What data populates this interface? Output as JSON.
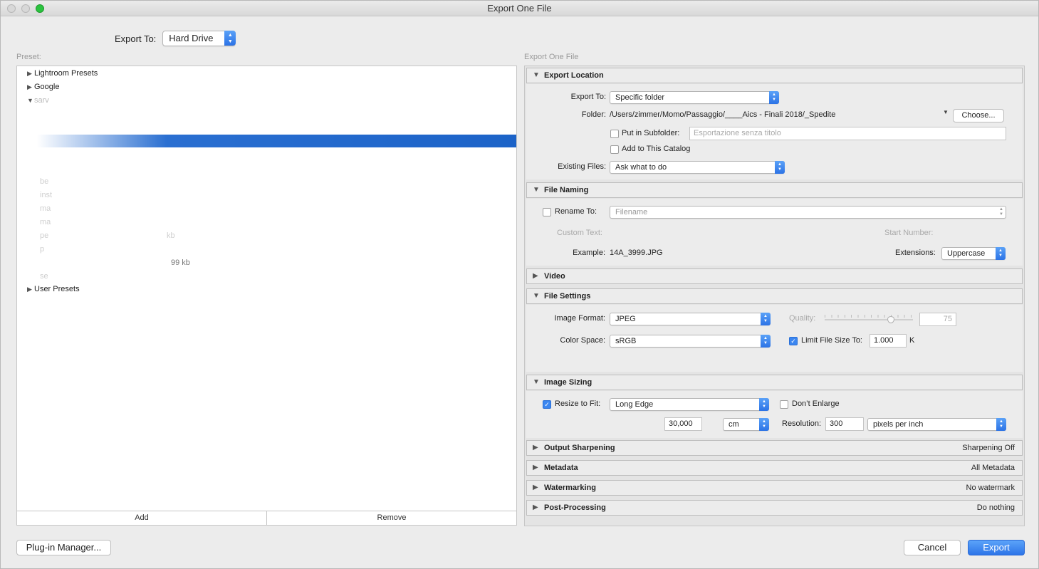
{
  "window": {
    "title": "Export One File"
  },
  "top": {
    "export_to_label": "Export To:",
    "export_to_value": "Hard Drive"
  },
  "preset": {
    "caption": "Preset:",
    "items": [
      {
        "label": "Lightroom Presets",
        "expanded": false
      },
      {
        "label": "Google",
        "expanded": false
      },
      {
        "label": "sarv",
        "expanded": true
      },
      {
        "label": "User Presets",
        "expanded": false
      }
    ],
    "faded_items": [
      "be",
      "inst",
      "ma",
      "ma",
      "pe",
      "kb",
      "p",
      "99 kb",
      "se"
    ],
    "add_label": "Add",
    "remove_label": "Remove"
  },
  "right": {
    "caption": "Export One File"
  },
  "export_location": {
    "title": "Export Location",
    "export_to_label": "Export To:",
    "export_to_value": "Specific folder",
    "folder_label": "Folder:",
    "folder_path": "/Users/zimmer/Momo/Passaggio/____Aics - Finali 2018/_Spedite",
    "choose_label": "Choose...",
    "subfolder_label": "Put in Subfolder:",
    "subfolder_placeholder": "Esportazione senza titolo",
    "add_catalog_label": "Add to This Catalog",
    "existing_files_label": "Existing Files:",
    "existing_files_value": "Ask what to do"
  },
  "file_naming": {
    "title": "File Naming",
    "rename_label": "Rename To:",
    "rename_value": "Filename",
    "custom_text_label": "Custom Text:",
    "start_number_label": "Start Number:",
    "example_label": "Example:",
    "example_value": "14A_3999.JPG",
    "extensions_label": "Extensions:",
    "extensions_value": "Uppercase"
  },
  "video": {
    "title": "Video"
  },
  "file_settings": {
    "title": "File Settings",
    "image_format_label": "Image Format:",
    "image_format_value": "JPEG",
    "quality_label": "Quality:",
    "quality_value": "75",
    "quality_level": 0.75,
    "color_space_label": "Color Space:",
    "color_space_value": "sRGB",
    "limit_size_label": "Limit File Size To:",
    "limit_size_value": "1.000",
    "limit_size_unit": "K"
  },
  "image_sizing": {
    "title": "Image Sizing",
    "resize_label": "Resize to Fit:",
    "resize_value": "Long Edge",
    "dont_enlarge_label": "Don’t Enlarge",
    "size_value": "30,000",
    "size_unit": "cm",
    "resolution_label": "Resolution:",
    "resolution_value": "300",
    "resolution_unit": "pixels per inch"
  },
  "output_sharpening": {
    "title": "Output Sharpening",
    "summary": "Sharpening Off"
  },
  "metadata": {
    "title": "Metadata",
    "summary": "All Metadata"
  },
  "watermarking": {
    "title": "Watermarking",
    "summary": "No watermark"
  },
  "post_processing": {
    "title": "Post-Processing",
    "summary": "Do nothing"
  },
  "footer": {
    "plugin_manager_label": "Plug-in Manager...",
    "cancel_label": "Cancel",
    "export_label": "Export"
  },
  "colors": {
    "accent": "#2d75e8",
    "selection": "#1c63c8"
  }
}
